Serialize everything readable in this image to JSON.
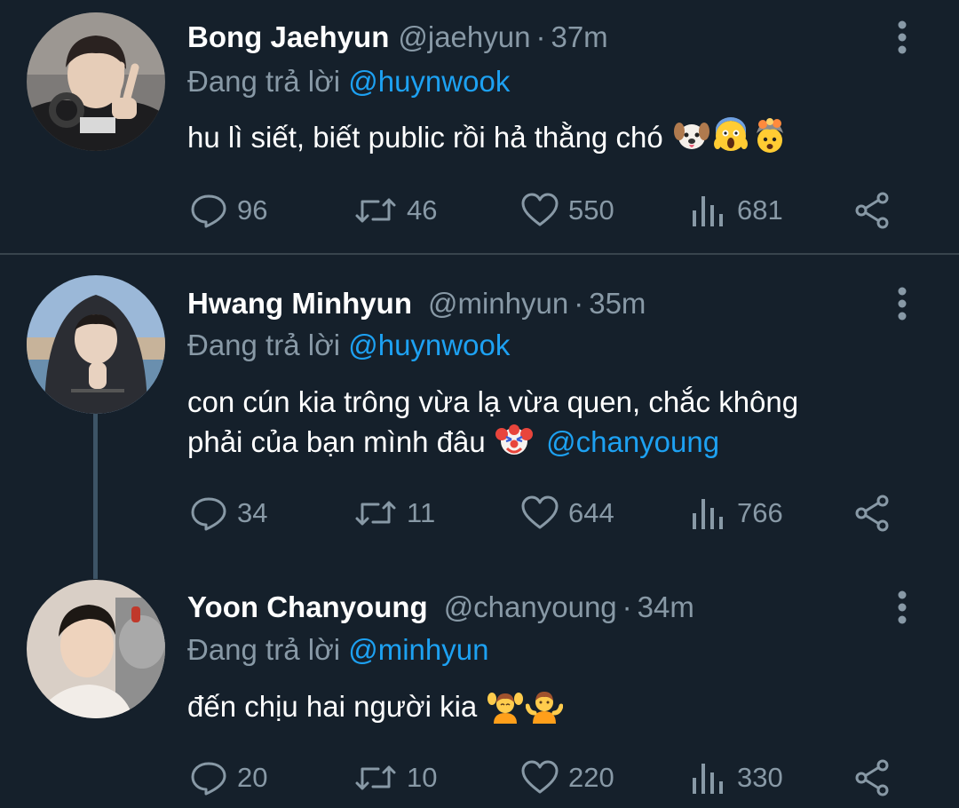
{
  "colors": {
    "background": "#15202b",
    "primary_text": "#ffffff",
    "secondary_text": "#8899a6",
    "accent": "#1da1f2",
    "divider": "#38444d",
    "thread_line": "#3d5466"
  },
  "tweets": [
    {
      "name": "Bong Jaehyun",
      "handle": "@jaehyun",
      "separator": "·",
      "time": "37m",
      "reply_prefix": "Đang trả lời",
      "reply_to": "@huynwook",
      "text": "hu lì siết, biết public rồi hả thằng chó",
      "emojis": [
        "dog-face-emoji",
        "screaming-face-emoji",
        "exploding-head-emoji"
      ],
      "replies": "96",
      "retweets": "46",
      "likes": "550",
      "views": "681"
    },
    {
      "name": "Hwang Minhyun",
      "handle": "@minhyun",
      "separator": "·",
      "time": "35m",
      "reply_prefix": "Đang trả lời",
      "reply_to": "@huynwook",
      "text_line1": "con cún kia trông vừa lạ vừa quen, chắc không",
      "text_line2": "phải của bạn mình đâu",
      "emojis": [
        "clown-face-emoji"
      ],
      "mention": "@chanyoung",
      "replies": "34",
      "retweets": "11",
      "likes": "644",
      "views": "766"
    },
    {
      "name": "Yoon Chanyoung",
      "handle": "@chanyoung",
      "separator": "·",
      "time": "34m",
      "reply_prefix": "Đang trả lời",
      "reply_to": "@minhyun",
      "text": "đến chịu hai người kia",
      "emojis": [
        "person-getting-massage-emoji",
        "person-shrugging-emoji"
      ],
      "replies": "20",
      "retweets": "10",
      "likes": "220",
      "views": "330"
    }
  ]
}
